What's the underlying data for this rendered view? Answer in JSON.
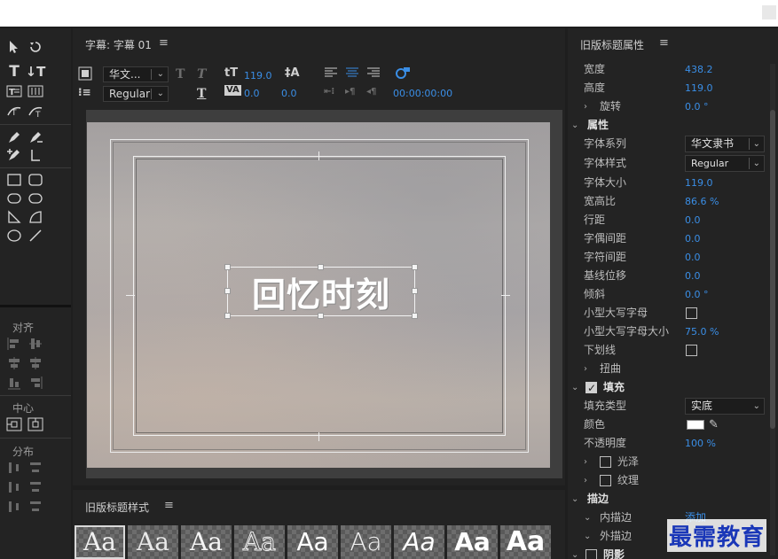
{
  "tools": {
    "align_label": "对齐",
    "center_label": "中心",
    "distribute_label": "分布"
  },
  "title_panel": {
    "title": "字幕: 字幕 01",
    "font_family": "华文...",
    "font_style": "Regular",
    "font_size": "119.0",
    "kerning": "0.0",
    "tracking": "0.0",
    "timecode": "00:00:00:00",
    "canvas_text": "回忆时刻"
  },
  "styles_panel": {
    "title": "旧版标题样式",
    "swatches": [
      "Aa",
      "Aa",
      "Aa",
      "Aa",
      "Aa",
      "Aa",
      "Aa",
      "Aa",
      "Aa"
    ]
  },
  "props_panel": {
    "title": "旧版标题属性",
    "width_label": "宽度",
    "width_val": "438.2",
    "height_label": "高度",
    "height_val": "119.0",
    "rotate_label": "旋转",
    "rotate_val": "0.0 °",
    "attr_section": "属性",
    "font_family_label": "字体系列",
    "font_family_val": "华文隶书",
    "font_style_label": "字体样式",
    "font_style_val": "Regular",
    "font_size_label": "字体大小",
    "font_size_val": "119.0",
    "aspect_label": "宽高比",
    "aspect_val": "86.6 %",
    "leading_label": "行距",
    "leading_val": "0.0",
    "kerning_label": "字偶间距",
    "kerning_val": "0.0",
    "tracking_label": "字符间距",
    "tracking_val": "0.0",
    "baseline_label": "基线位移",
    "baseline_val": "0.0",
    "slant_label": "倾斜",
    "slant_val": "0.0 °",
    "smallcaps_label": "小型大写字母",
    "smallcaps_size_label": "小型大写字母大小",
    "smallcaps_size_val": "75.0 %",
    "underline_label": "下划线",
    "distort_label": "扭曲",
    "fill_section": "填充",
    "fill_type_label": "填充类型",
    "fill_type_val": "实底",
    "color_label": "颜色",
    "opacity_label": "不透明度",
    "opacity_val": "100 %",
    "sheen_label": "光泽",
    "texture_label": "纹理",
    "stroke_section": "描边",
    "inner_stroke_label": "内描边",
    "add_link": "添加",
    "outer_stroke_label": "外描边",
    "shadow_label": "阴影",
    "fill_color": "#ffffff"
  },
  "watermark": "最需教育"
}
